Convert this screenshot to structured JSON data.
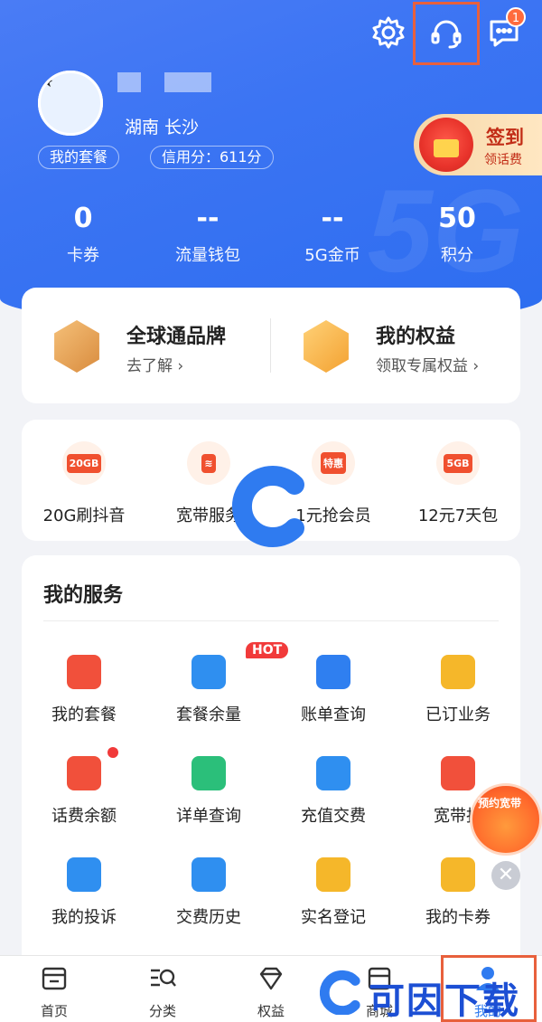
{
  "header": {
    "location": "湖南  长沙",
    "package_link": "我的套餐",
    "credit_link": "信用分：611分",
    "message_badge": "1",
    "signin": {
      "title": "签到",
      "subtitle": "领话费"
    },
    "stats": [
      {
        "value": "0",
        "label": "卡券"
      },
      {
        "value": "--",
        "label": "流量钱包"
      },
      {
        "value": "--",
        "label": "5G金币"
      },
      {
        "value": "50",
        "label": "积分"
      }
    ]
  },
  "brand": [
    {
      "title": "全球通品牌",
      "sub": "去了解 ›"
    },
    {
      "title": "我的权益",
      "sub": "领取专属权益 ›"
    }
  ],
  "promos": [
    {
      "tag": "20GB",
      "label": "20G刷抖音"
    },
    {
      "tag": "≋",
      "label": "宽带服务"
    },
    {
      "tag": "特惠",
      "label": "1元抢会员"
    },
    {
      "tag": "5GB",
      "label": "12元7天包"
    }
  ],
  "services": {
    "title": "我的服务",
    "hot": "HOT",
    "items": [
      {
        "label": "我的套餐",
        "color": "#f1503b"
      },
      {
        "label": "套餐余量",
        "color": "#2f8ff0"
      },
      {
        "label": "账单查询",
        "color": "#2f7ff0"
      },
      {
        "label": "已订业务",
        "color": "#f5b72a"
      },
      {
        "label": "话费余额",
        "color": "#f1503b"
      },
      {
        "label": "详单查询",
        "color": "#2bbf7a"
      },
      {
        "label": "充值交费",
        "color": "#2f8ff0"
      },
      {
        "label": "宽带报",
        "color": "#f1503b"
      },
      {
        "label": "我的投诉",
        "color": "#2f8ff0"
      },
      {
        "label": "交费历史",
        "color": "#2f8ff0"
      },
      {
        "label": "实名登记",
        "color": "#f5b72a"
      },
      {
        "label": "我的卡券",
        "color": "#f5b72a"
      }
    ]
  },
  "float_promo": "预约宽带",
  "watermark_text": "可因下载",
  "tabs": [
    {
      "label": "首页"
    },
    {
      "label": "分类"
    },
    {
      "label": "权益"
    },
    {
      "label": "商城"
    },
    {
      "label": "我的"
    }
  ]
}
